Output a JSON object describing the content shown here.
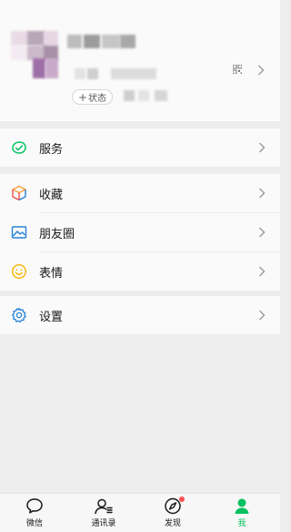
{
  "profile": {
    "status_plus": "+",
    "status_label": "状态"
  },
  "menu": {
    "services": "服务",
    "favorites": "收藏",
    "moments": "朋友圈",
    "stickers": "表情",
    "settings": "设置"
  },
  "tabbar": {
    "chats": "微信",
    "contacts": "通讯录",
    "discover": "发现",
    "me": "我"
  },
  "colors": {
    "accent": "#07c160",
    "badge": "#fa5151"
  }
}
